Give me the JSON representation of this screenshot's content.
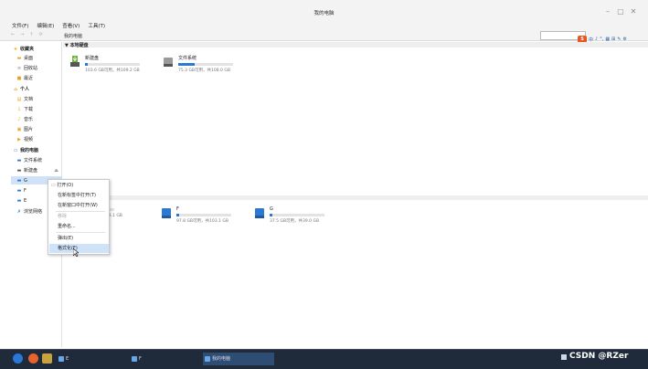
{
  "window": {
    "title": "我的电脑",
    "min": "–",
    "max": "▢",
    "close": "✕"
  },
  "menu": [
    "文件(F)",
    "编辑(E)",
    "查看(V)",
    "工具(T)"
  ],
  "toolbar": {
    "back": "←",
    "forward": "→",
    "up": "↑",
    "history": "⟳",
    "path": "我的电脑"
  },
  "ime": {
    "logo": "S",
    "items": [
      "中",
      "♪",
      "°,",
      "▦",
      "⊞",
      "✎",
      "⚙"
    ]
  },
  "sidebar": {
    "favorites_title": "收藏夹",
    "favorites": [
      "桌面",
      "回收站",
      "最近"
    ],
    "personal_title": "个人",
    "personal": [
      "文档",
      "下载",
      "音乐",
      "图片",
      "视频"
    ],
    "computer_title": "我的电脑",
    "computer": [
      "文件系统",
      "新建盘",
      "G",
      "F",
      "E"
    ],
    "network": "浏览网络",
    "eject_icon": "⏏"
  },
  "content": {
    "section_local": "▼ 本地硬盘",
    "drives_top": [
      {
        "name": "新建盘",
        "info": "103.6 GB可用，共109.2 GB",
        "used": 0.05
      },
      {
        "name": "文件系统",
        "info": "75.3 GB可用，共108.0 GB",
        "used": 0.3
      }
    ],
    "drives_bottom": [
      {
        "name": "",
        "info": "可用，共103.1 GB",
        "used": 0.05
      },
      {
        "name": "F",
        "info": "97.8 GB可用，共103.1 GB",
        "used": 0.05
      },
      {
        "name": "G",
        "info": "37.5 GB可用，共39.0 GB",
        "used": 0.05
      }
    ]
  },
  "context_menu": {
    "items": [
      "打开(O)",
      "在新标签中打开(T)",
      "在新窗口中打开(W)",
      "移除",
      "重命名...",
      "弹出(E)",
      "格式化(F)"
    ]
  },
  "taskbar": {
    "tasks": [
      "E",
      "F",
      "我的电脑"
    ],
    "watermark": "CSDN @RZer"
  }
}
